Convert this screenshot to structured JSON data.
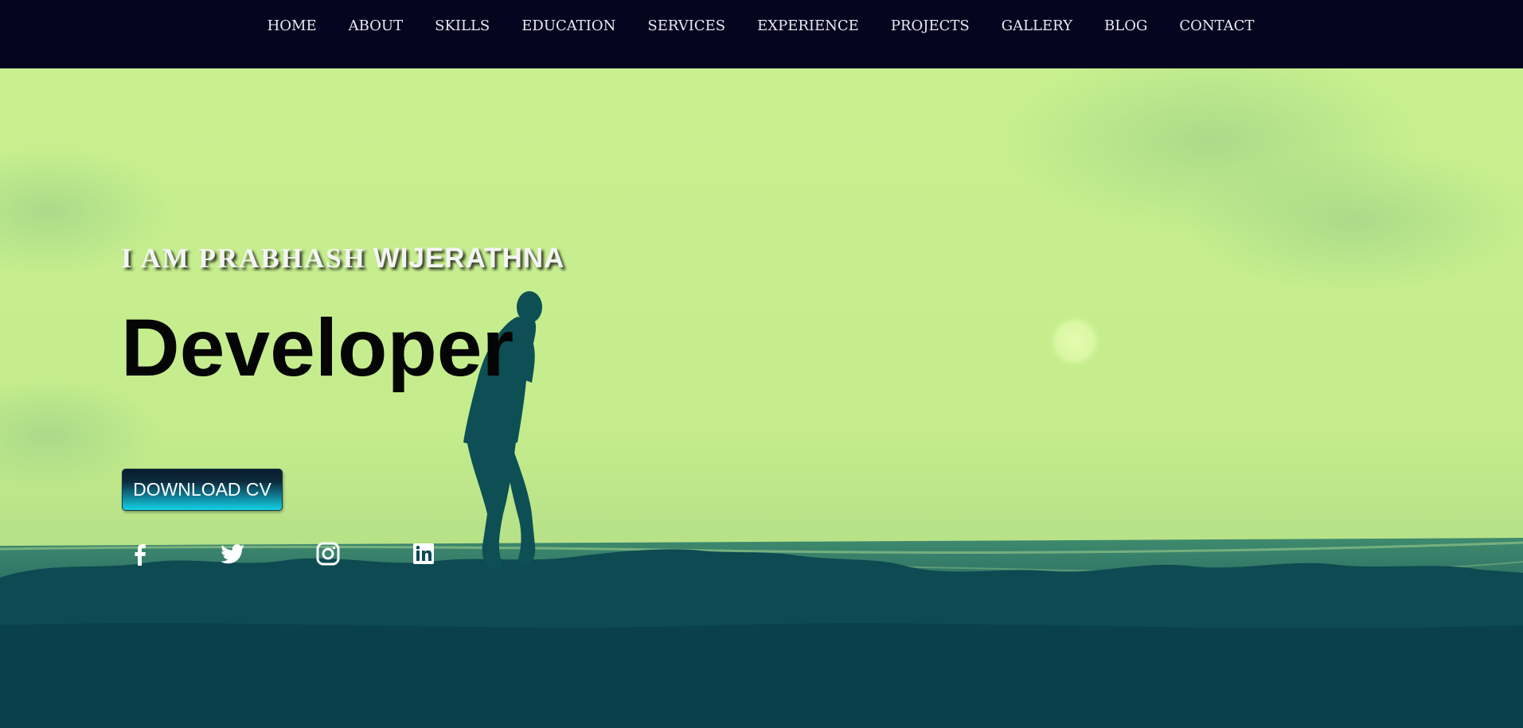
{
  "nav": {
    "items": [
      {
        "label": "HOME"
      },
      {
        "label": "ABOUT"
      },
      {
        "label": "SKILLS"
      },
      {
        "label": "EDUCATION"
      },
      {
        "label": "SERVICES"
      },
      {
        "label": "EXPERIENCE"
      },
      {
        "label": "PROJECTS"
      },
      {
        "label": "GALLERY"
      },
      {
        "label": "BLOG"
      },
      {
        "label": "CONTACT"
      }
    ]
  },
  "hero": {
    "intro_prefix": "I AM PRABHASH",
    "intro_name": "WIJERATHNA",
    "role": "Developer",
    "cv_button": "DOWNLOAD CV"
  },
  "social": [
    {
      "icon": "facebook-icon"
    },
    {
      "icon": "twitter-icon"
    },
    {
      "icon": "instagram-icon"
    },
    {
      "icon": "linkedin-icon"
    }
  ],
  "colors": {
    "nav_background": "#05051f",
    "sky": "#c9f18f",
    "silhouette": "#0b4b52",
    "text_light": "#f4f4f4",
    "button_accent": "#12d2e6"
  }
}
